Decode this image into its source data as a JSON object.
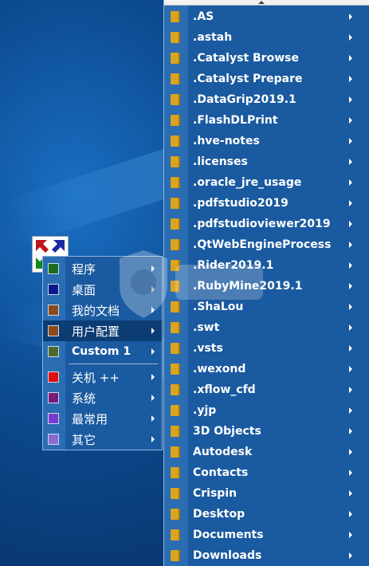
{
  "main_menu": {
    "items": [
      {
        "label": "程序",
        "color": "#1e6b1e",
        "latin": false,
        "selected": false
      },
      {
        "label": "桌面",
        "color": "#0a1a8c",
        "latin": false,
        "selected": false
      },
      {
        "label": "我的文档",
        "color": "#8a4a1a",
        "latin": false,
        "selected": false
      },
      {
        "label": "用户配置",
        "color": "#8a4a1a",
        "latin": false,
        "selected": true
      },
      {
        "label": "Custom 1",
        "color": "#4e6a30",
        "latin": true,
        "selected": false
      },
      {
        "label": "关机 ++",
        "color": "#e01010",
        "latin": false,
        "selected": false
      },
      {
        "label": "系统",
        "color": "#7a1a7a",
        "latin": false,
        "selected": false
      },
      {
        "label": "最常用",
        "color": "#7a3ad0",
        "latin": false,
        "selected": false
      },
      {
        "label": "其它",
        "color": "#8a6ad0",
        "latin": false,
        "selected": false
      }
    ]
  },
  "sub_menu": {
    "items": [
      {
        "label": ".AS"
      },
      {
        "label": ".astah"
      },
      {
        "label": ".Catalyst Browse"
      },
      {
        "label": ".Catalyst Prepare"
      },
      {
        "label": ".DataGrip2019.1"
      },
      {
        "label": ".FlashDLPrint"
      },
      {
        "label": ".hve-notes"
      },
      {
        "label": ".licenses"
      },
      {
        "label": ".oracle_jre_usage"
      },
      {
        "label": ".pdfstudio2019"
      },
      {
        "label": ".pdfstudioviewer2019"
      },
      {
        "label": ".QtWebEngineProcess"
      },
      {
        "label": ".Rider2019.1"
      },
      {
        "label": ".RubyMine2019.1"
      },
      {
        "label": ".ShaLou"
      },
      {
        "label": ".swt"
      },
      {
        "label": ".vsts"
      },
      {
        "label": ".wexond"
      },
      {
        "label": ".xflow_cfd"
      },
      {
        "label": ".yjp"
      },
      {
        "label": "3D Objects"
      },
      {
        "label": "Autodesk"
      },
      {
        "label": "Contacts"
      },
      {
        "label": "Crispin"
      },
      {
        "label": "Desktop"
      },
      {
        "label": "Documents"
      },
      {
        "label": "Downloads"
      }
    ]
  },
  "colors": {
    "menu_bg": "#1a5aa0",
    "selected_bg": "#0b3c74",
    "folder": "#d9a421"
  }
}
